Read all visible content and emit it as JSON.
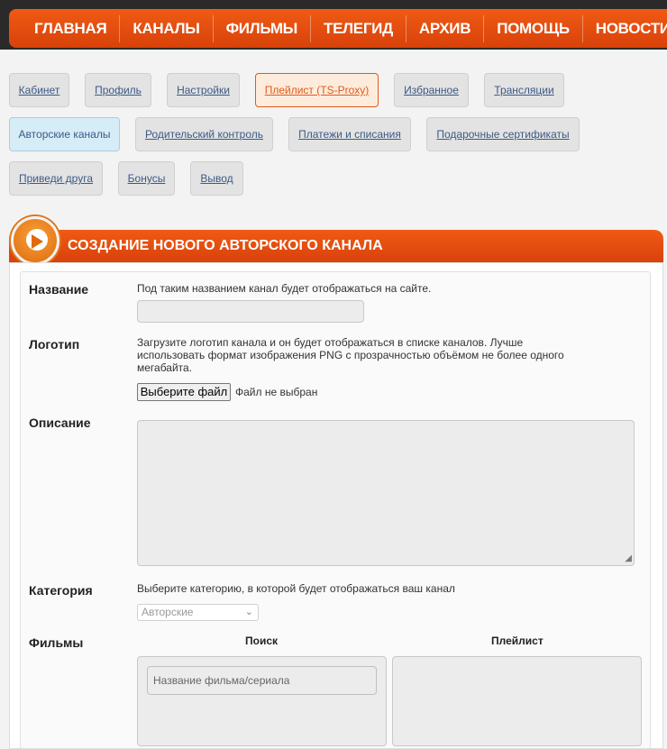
{
  "nav": [
    "ГЛАВНАЯ",
    "КАНАЛЫ",
    "ФИЛЬМЫ",
    "ТЕЛЕГИД",
    "АРХИВ",
    "ПОМОЩЬ",
    "НОВОСТИ"
  ],
  "tabs": [
    {
      "label": "Кабинет"
    },
    {
      "label": "Профиль"
    },
    {
      "label": "Настройки"
    },
    {
      "label": "Плейлист (TS-Proxy)"
    },
    {
      "label": "Избранное"
    },
    {
      "label": "Трансляции"
    },
    {
      "label": "Авторские каналы"
    },
    {
      "label": "Родительский контроль"
    },
    {
      "label": "Платежи и списания"
    },
    {
      "label": "Подарочные сертификаты"
    },
    {
      "label": "Приведи друга"
    },
    {
      "label": "Бонусы"
    },
    {
      "label": "Вывод"
    }
  ],
  "panel": {
    "title": "СОЗДАНИЕ НОВОГО АВТОРСКОГО КАНАЛА"
  },
  "form": {
    "name_label": "Название",
    "name_hint": "Под таким названием канал будет отображаться на сайте.",
    "logo_label": "Логотип",
    "logo_hint": "Загрузите логотип канала и он будет отображаться в списке каналов. Лучше использовать формат изображения PNG с прозрачностью объёмом не более одного мегабайта.",
    "file_button": "Выберите файл",
    "file_status": "Файл не выбран",
    "desc_label": "Описание",
    "category_label": "Категория",
    "category_hint": "Выберите категорию, в которой будет отображаться ваш канал",
    "category_value": "Авторские",
    "films_label": "Фильмы",
    "search_header": "Поиск",
    "playlist_header": "Плейлист",
    "search_placeholder": "Название фильма/сериала"
  }
}
